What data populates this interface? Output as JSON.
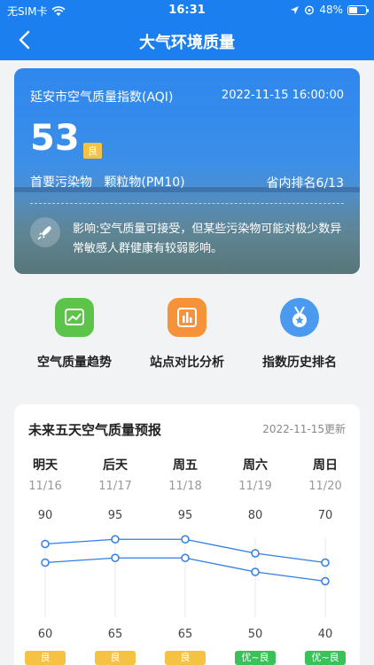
{
  "status": {
    "carrier": "无SIM卡",
    "time": "16:31",
    "battery": "48%",
    "battery_level": 0.48
  },
  "header": {
    "title": "大气环境质量"
  },
  "aqi": {
    "city_title": "延安市空气质量指数(AQI)",
    "datetime": "2022-11-15 16:00:00",
    "value": "53",
    "level": "良",
    "primary_pollutant_label": "首要污染物",
    "primary_pollutant": "颗粒物(PM10)",
    "rank": "省内排名6/13",
    "impact": "影响:空气质量可接受，但某些污染物可能对极少数异常敏感人群健康有较弱影响。"
  },
  "shortcuts": [
    {
      "label": "空气质量趋势",
      "icon": "trend-chart-icon",
      "color": "#5dc44a"
    },
    {
      "label": "站点对比分析",
      "icon": "bar-chart-icon",
      "color": "#f6923a"
    },
    {
      "label": "指数历史排名",
      "icon": "medal-icon",
      "color": "#4a9bf0"
    }
  ],
  "forecast": {
    "title": "未来五天空气质量预报",
    "updated": "2022-11-15更新",
    "days": [
      {
        "day": "明天",
        "date": "11/16",
        "high": 90,
        "low": 60,
        "level": "良"
      },
      {
        "day": "后天",
        "date": "11/17",
        "high": 95,
        "low": 65,
        "level": "良"
      },
      {
        "day": "周五",
        "date": "11/18",
        "high": 95,
        "low": 65,
        "level": "良"
      },
      {
        "day": "周六",
        "date": "11/19",
        "high": 80,
        "low": 50,
        "level": "优~良"
      },
      {
        "day": "周日",
        "date": "11/20",
        "high": 70,
        "low": 40,
        "level": "优~良"
      }
    ],
    "colors": {
      "line": "#2f7fe4",
      "good": "#f5c243",
      "excellent_good": "#39c15a"
    }
  }
}
